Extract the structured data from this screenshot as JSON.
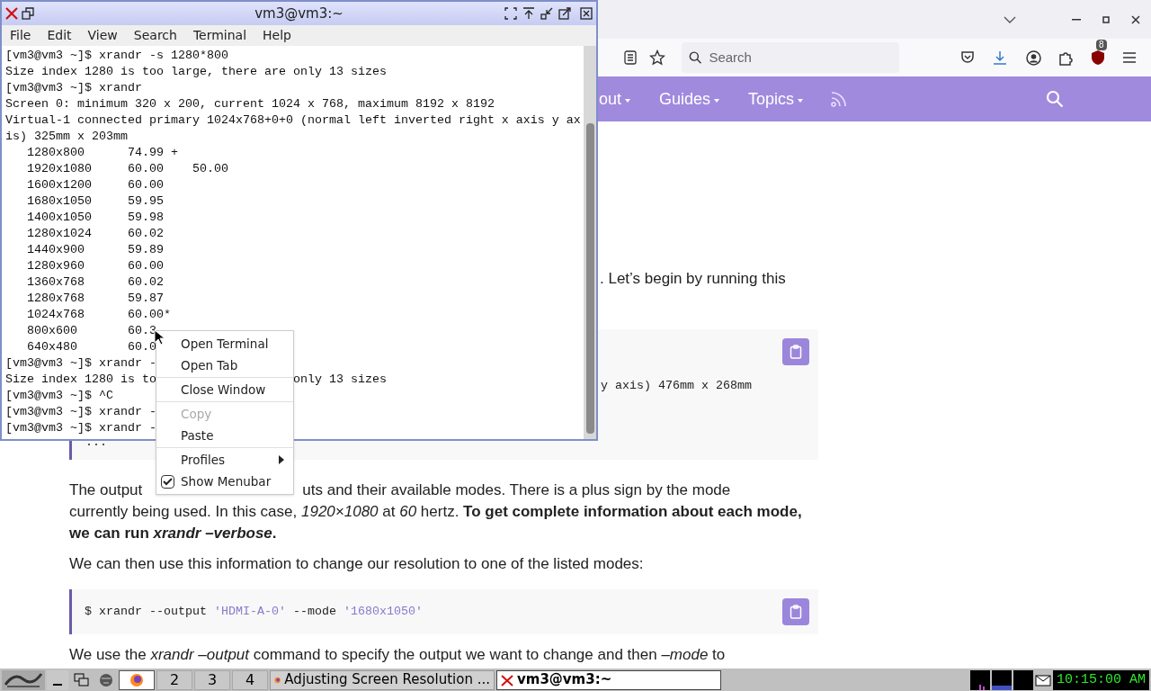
{
  "browser": {
    "search": {
      "placeholder": "Search"
    },
    "extension_badge": "8",
    "nav": [
      {
        "label": "out"
      },
      {
        "label": "Guides"
      },
      {
        "label": "Topics"
      }
    ]
  },
  "article": {
    "intro_tail": ". Let’s begin by running this",
    "code_block_1": {
      "visible_text": "y axis) 476mm x 268mm",
      "ellipsis": "..."
    },
    "paragraph_1": {
      "head": "The output",
      "tail": "uts and their available modes. There is a plus sign by the mode",
      "rest": "currently being used. In this case, *1920×1080* at *60* hertz. **To get complete information about each mode, we can run *xrandr –verbose*.**"
    },
    "paragraph_2": "We can then use this information to change our resolution to one of the listed modes:",
    "code_block_2": {
      "parts": [
        {
          "text": "$ xrandr --output ",
          "kind": "plain"
        },
        {
          "text": "'HDMI-A-0'",
          "kind": "string"
        },
        {
          "text": " --mode ",
          "kind": "plain"
        },
        {
          "text": "'1680x1050'",
          "kind": "string"
        }
      ]
    },
    "paragraph_3": "We use the *xrandr –output* command to specify the output we want to change and then *–mode* to"
  },
  "terminal": {
    "title": "vm3@vm3:~",
    "menu": [
      "File",
      "Edit",
      "View",
      "Search",
      "Terminal",
      "Help"
    ],
    "lines": [
      {
        "text": "[vm3@vm3 ~]$ xrandr -s 1280*800"
      },
      {
        "text": "Size index 1280 is too large, there are only 13 sizes"
      },
      {
        "text": "[vm3@vm3 ~]$ xrandr"
      },
      {
        "text": "Screen 0: minimum 320 x 200, current 1024 x 768, maximum 8192 x 8192"
      },
      {
        "text": "Virtual-1 connected primary 1024x768+0+0 (normal left inverted right x axis y ax"
      },
      {
        "text": "is) 325mm x 203mm"
      },
      {
        "text": "   1280x800      74.99 +"
      },
      {
        "text": "   1920x1080     60.00    50.00"
      },
      {
        "text": "   1600x1200     60.00"
      },
      {
        "text": "   1680x1050     59.95"
      },
      {
        "text": "   1400x1050     59.98"
      },
      {
        "text": "   1280x1024     60.02"
      },
      {
        "text": "   1440x900      59.89"
      },
      {
        "text": "   1280x960      60.00"
      },
      {
        "text": "   1360x768      60.02"
      },
      {
        "text": "   1280x768      59.87"
      },
      {
        "text": "   1024x768      60.00*"
      },
      {
        "text": "   800x600       60.3"
      },
      {
        "text": "   640x480       60.0"
      },
      {
        "text": "[vm3@vm3 ~]$ xrandr -"
      },
      {
        "text": "Size index 1280 is to",
        "tail": "only 13 sizes"
      },
      {
        "text": "[vm3@vm3 ~]$ ^C"
      },
      {
        "text": "[vm3@vm3 ~]$ xrandr -"
      },
      {
        "text": "[vm3@vm3 ~]$ xrandr -"
      }
    ]
  },
  "context_menu": [
    {
      "kind": "item",
      "label": "Open Terminal",
      "disabled": false
    },
    {
      "kind": "item",
      "label": "Open Tab",
      "disabled": false
    },
    {
      "kind": "separator"
    },
    {
      "kind": "item",
      "label": "Close Window",
      "disabled": false
    },
    {
      "kind": "separator"
    },
    {
      "kind": "item",
      "label": "Copy",
      "disabled": true
    },
    {
      "kind": "item",
      "label": "Paste",
      "disabled": false
    },
    {
      "kind": "separator"
    },
    {
      "kind": "submenu",
      "label": "Profiles",
      "disabled": false
    },
    {
      "kind": "check",
      "label": "Show Menubar",
      "checked": true,
      "disabled": false
    }
  ],
  "taskbar": {
    "workspaces": [
      {
        "selected": true
      },
      {
        "label": "2",
        "selected": false
      },
      {
        "label": "3",
        "selected": false
      },
      {
        "label": "4",
        "selected": false
      }
    ],
    "tasks": [
      {
        "kind": "browser",
        "title": "Adjusting Screen Resolution ...",
        "active": false
      },
      {
        "kind": "terminal",
        "title": "vm3@vm3:~",
        "active": true
      }
    ],
    "clock": "10:15:00 AM"
  }
}
